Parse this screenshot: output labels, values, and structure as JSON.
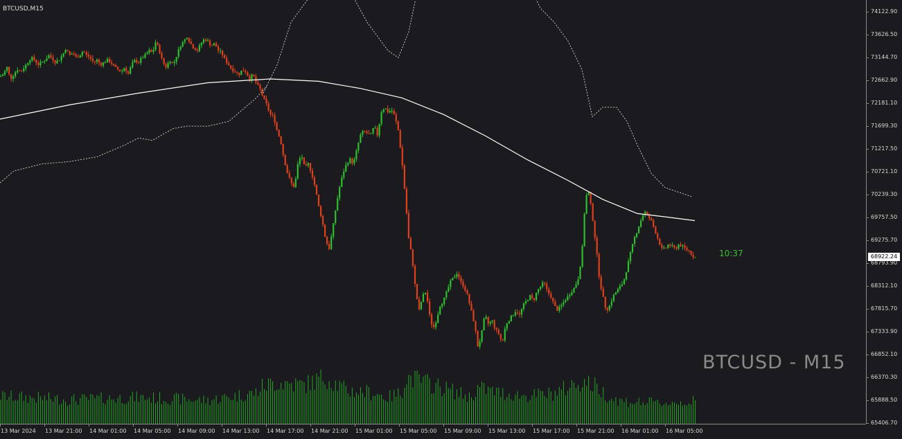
{
  "chart_window": {
    "symbol_label": "BTCUSD,M15",
    "watermark": "BTCUSD - M15",
    "candle_timer": "10:37",
    "current_price": "68922.24"
  },
  "colors": {
    "background": "#1b1b1f",
    "bull_candle": "#2fbf2f",
    "bear_candle": "#e0401c",
    "volume": "#22a822",
    "moving_average": "#ffffff",
    "envelope": "#d8d8d8"
  },
  "chart_data": {
    "type": "candlestick",
    "price_axis_labels": [
      "74122.90",
      "73626.50",
      "73144.70",
      "72662.90",
      "72181.10",
      "71699.30",
      "71217.50",
      "70721.10",
      "70239.30",
      "69757.50",
      "69275.70",
      "68793.90",
      "68312.10",
      "67815.70",
      "67333.90",
      "66852.10",
      "66370.30",
      "65888.50",
      "65406.70"
    ],
    "time_axis_labels": [
      "13 Mar 2024",
      "13 Mar 21:00",
      "14 Mar 01:00",
      "14 Mar 05:00",
      "14 Mar 09:00",
      "14 Mar 13:00",
      "14 Mar 17:00",
      "14 Mar 21:00",
      "15 Mar 01:00",
      "15 Mar 05:00",
      "15 Mar 09:00",
      "15 Mar 13:00",
      "15 Mar 17:00",
      "15 Mar 21:00",
      "16 Mar 01:00",
      "16 Mar 05:00"
    ],
    "ylim": [
      65406.7,
      74122.9
    ],
    "close_path": [
      [
        0,
        72750
      ],
      [
        5,
        72800
      ],
      [
        10,
        72950
      ],
      [
        15,
        72700
      ],
      [
        20,
        72800
      ],
      [
        25,
        72900
      ],
      [
        30,
        72850
      ],
      [
        35,
        72950
      ],
      [
        40,
        73050
      ],
      [
        45,
        73150
      ],
      [
        50,
        73100
      ],
      [
        55,
        73000
      ],
      [
        60,
        73050
      ],
      [
        65,
        73100
      ],
      [
        70,
        73200
      ],
      [
        75,
        73150
      ],
      [
        80,
        73050
      ],
      [
        85,
        73100
      ],
      [
        90,
        73200
      ],
      [
        95,
        73350
      ],
      [
        100,
        73200
      ],
      [
        105,
        73250
      ],
      [
        110,
        73150
      ],
      [
        115,
        73200
      ],
      [
        120,
        73300
      ],
      [
        125,
        73200
      ],
      [
        130,
        73150
      ],
      [
        135,
        73050
      ],
      [
        140,
        73100
      ],
      [
        145,
        73000
      ],
      [
        150,
        73050
      ],
      [
        155,
        73100
      ],
      [
        160,
        73050
      ],
      [
        165,
        72950
      ],
      [
        170,
        72900
      ],
      [
        175,
        72850
      ],
      [
        180,
        72950
      ],
      [
        185,
        72800
      ],
      [
        190,
        73000
      ],
      [
        195,
        73100
      ],
      [
        200,
        73050
      ],
      [
        205,
        73150
      ],
      [
        210,
        73200
      ],
      [
        215,
        73300
      ],
      [
        220,
        73250
      ],
      [
        225,
        73500
      ],
      [
        230,
        73300
      ],
      [
        235,
        73050
      ],
      [
        240,
        72950
      ],
      [
        245,
        73100
      ],
      [
        250,
        73000
      ],
      [
        255,
        73200
      ],
      [
        260,
        73400
      ],
      [
        265,
        73500
      ],
      [
        270,
        73600
      ],
      [
        275,
        73450
      ],
      [
        280,
        73350
      ],
      [
        285,
        73300
      ],
      [
        290,
        73450
      ],
      [
        295,
        73550
      ],
      [
        300,
        73500
      ],
      [
        305,
        73400
      ],
      [
        310,
        73450
      ],
      [
        315,
        73300
      ],
      [
        320,
        73250
      ],
      [
        325,
        73100
      ],
      [
        330,
        73000
      ],
      [
        335,
        72900
      ],
      [
        340,
        72850
      ],
      [
        345,
        72800
      ],
      [
        350,
        72900
      ],
      [
        355,
        72850
      ],
      [
        360,
        72700
      ],
      [
        365,
        72800
      ],
      [
        370,
        72600
      ],
      [
        375,
        72500
      ],
      [
        380,
        72300
      ],
      [
        385,
        72150
      ],
      [
        390,
        71950
      ],
      [
        395,
        71900
      ],
      [
        400,
        71600
      ],
      [
        405,
        71400
      ],
      [
        410,
        71000
      ],
      [
        415,
        70700
      ],
      [
        420,
        70500
      ],
      [
        425,
        70400
      ],
      [
        430,
        70900
      ],
      [
        435,
        71100
      ],
      [
        440,
        70800
      ],
      [
        445,
        70900
      ],
      [
        450,
        70700
      ],
      [
        455,
        70400
      ],
      [
        460,
        70000
      ],
      [
        465,
        69700
      ],
      [
        470,
        69300
      ],
      [
        475,
        69100
      ],
      [
        480,
        69500
      ],
      [
        485,
        70000
      ],
      [
        490,
        70400
      ],
      [
        495,
        70700
      ],
      [
        500,
        70900
      ],
      [
        505,
        71000
      ],
      [
        510,
        70900
      ],
      [
        515,
        71200
      ],
      [
        520,
        71500
      ],
      [
        525,
        71600
      ],
      [
        530,
        71550
      ],
      [
        535,
        71500
      ],
      [
        540,
        71700
      ],
      [
        545,
        71500
      ],
      [
        550,
        72000
      ],
      [
        555,
        72100
      ],
      [
        560,
        72000
      ],
      [
        565,
        72050
      ],
      [
        570,
        71900
      ],
      [
        575,
        71600
      ],
      [
        580,
        71000
      ],
      [
        585,
        70200
      ],
      [
        590,
        69300
      ],
      [
        595,
        68900
      ],
      [
        600,
        68200
      ],
      [
        605,
        67800
      ],
      [
        610,
        68100
      ],
      [
        615,
        68200
      ],
      [
        620,
        67700
      ],
      [
        625,
        67400
      ],
      [
        630,
        67600
      ],
      [
        635,
        67900
      ],
      [
        640,
        68000
      ],
      [
        645,
        68200
      ],
      [
        650,
        68400
      ],
      [
        655,
        68500
      ],
      [
        660,
        68600
      ],
      [
        665,
        68400
      ],
      [
        670,
        68300
      ],
      [
        675,
        68100
      ],
      [
        680,
        67800
      ],
      [
        685,
        67500
      ],
      [
        690,
        67000
      ],
      [
        695,
        67300
      ],
      [
        700,
        67700
      ],
      [
        705,
        67500
      ],
      [
        710,
        67600
      ],
      [
        715,
        67400
      ],
      [
        720,
        67300
      ],
      [
        725,
        67100
      ],
      [
        730,
        67500
      ],
      [
        735,
        67600
      ],
      [
        740,
        67700
      ],
      [
        745,
        67800
      ],
      [
        750,
        67700
      ],
      [
        755,
        67900
      ],
      [
        760,
        68000
      ],
      [
        765,
        68100
      ],
      [
        770,
        68000
      ],
      [
        775,
        68200
      ],
      [
        780,
        68300
      ],
      [
        785,
        68400
      ],
      [
        790,
        68200
      ],
      [
        795,
        68100
      ],
      [
        800,
        67900
      ],
      [
        805,
        67800
      ],
      [
        810,
        67900
      ],
      [
        815,
        68000
      ],
      [
        820,
        68100
      ],
      [
        825,
        68200
      ],
      [
        830,
        68300
      ],
      [
        835,
        68500
      ],
      [
        840,
        69000
      ],
      [
        845,
        70200
      ],
      [
        850,
        70300
      ],
      [
        855,
        69800
      ],
      [
        860,
        69200
      ],
      [
        865,
        68500
      ],
      [
        870,
        68100
      ],
      [
        875,
        67800
      ],
      [
        880,
        67900
      ],
      [
        885,
        68100
      ],
      [
        890,
        68200
      ],
      [
        895,
        68300
      ],
      [
        900,
        68400
      ],
      [
        905,
        68700
      ],
      [
        910,
        69000
      ],
      [
        915,
        69300
      ],
      [
        920,
        69500
      ],
      [
        925,
        69700
      ],
      [
        930,
        69900
      ],
      [
        935,
        69800
      ],
      [
        940,
        69700
      ],
      [
        945,
        69500
      ],
      [
        950,
        69300
      ],
      [
        955,
        69100
      ],
      [
        960,
        69100
      ],
      [
        965,
        69200
      ],
      [
        970,
        69150
      ],
      [
        975,
        69100
      ],
      [
        980,
        69200
      ],
      [
        985,
        69150
      ],
      [
        990,
        69100
      ],
      [
        995,
        69050
      ],
      [
        1000,
        68950
      ],
      [
        1004,
        68922
      ]
    ],
    "ma_path": [
      [
        0,
        71850
      ],
      [
        100,
        72150
      ],
      [
        200,
        72400
      ],
      [
        300,
        72620
      ],
      [
        390,
        72700
      ],
      [
        460,
        72650
      ],
      [
        520,
        72500
      ],
      [
        580,
        72300
      ],
      [
        640,
        71950
      ],
      [
        700,
        71500
      ],
      [
        760,
        71000
      ],
      [
        820,
        70550
      ],
      [
        870,
        70150
      ],
      [
        920,
        69850
      ],
      [
        960,
        69780
      ],
      [
        1003,
        69700
      ]
    ],
    "upper_band_path": [
      [
        380,
        72400
      ],
      [
        400,
        73000
      ],
      [
        420,
        73900
      ],
      [
        440,
        74300
      ],
      [
        460,
        74700
      ],
      [
        500,
        74700
      ],
      [
        530,
        73900
      ],
      [
        560,
        73300
      ],
      [
        575,
        73150
      ],
      [
        590,
        73700
      ],
      [
        600,
        74400
      ],
      [
        610,
        74800
      ],
      [
        760,
        74800
      ],
      [
        780,
        74200
      ],
      [
        800,
        73900
      ],
      [
        820,
        73500
      ],
      [
        840,
        72900
      ],
      [
        855,
        71900
      ],
      [
        870,
        72100
      ],
      [
        890,
        72100
      ],
      [
        905,
        71800
      ],
      [
        920,
        71300
      ],
      [
        940,
        70700
      ],
      [
        960,
        70400
      ],
      [
        980,
        70300
      ],
      [
        1000,
        70200
      ]
    ],
    "lower_band_path": [
      [
        0,
        70500
      ],
      [
        20,
        70750
      ],
      [
        60,
        70900
      ],
      [
        100,
        70950
      ],
      [
        140,
        71050
      ],
      [
        180,
        71300
      ],
      [
        200,
        71450
      ],
      [
        220,
        71400
      ],
      [
        250,
        71650
      ],
      [
        270,
        71700
      ],
      [
        300,
        71700
      ],
      [
        330,
        71800
      ],
      [
        350,
        72050
      ],
      [
        370,
        72300
      ],
      [
        385,
        72550
      ]
    ],
    "volume_path": [
      [
        0,
        40
      ],
      [
        100,
        35
      ],
      [
        200,
        38
      ],
      [
        300,
        34
      ],
      [
        370,
        45
      ],
      [
        380,
        55
      ],
      [
        400,
        60
      ],
      [
        440,
        56
      ],
      [
        470,
        68
      ],
      [
        500,
        48
      ],
      [
        540,
        45
      ],
      [
        560,
        38
      ],
      [
        580,
        45
      ],
      [
        585,
        68
      ],
      [
        600,
        64
      ],
      [
        640,
        52
      ],
      [
        680,
        38
      ],
      [
        690,
        52
      ],
      [
        720,
        45
      ],
      [
        760,
        40
      ],
      [
        800,
        44
      ],
      [
        840,
        62
      ],
      [
        860,
        54
      ],
      [
        880,
        38
      ],
      [
        900,
        32
      ],
      [
        960,
        30
      ],
      [
        1000,
        32
      ]
    ]
  }
}
